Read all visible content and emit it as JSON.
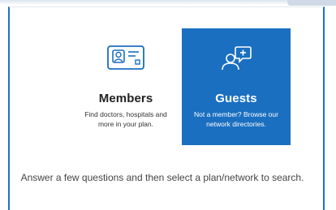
{
  "colors": {
    "accent": "#1a6fc0",
    "panel_border": "#1a73c7",
    "text_dark": "#222222",
    "text_muted": "#444444"
  },
  "cards": {
    "members": {
      "icon": "member-id-card-icon",
      "title": "Members",
      "description": "Find doctors, hospitals and more in your plan."
    },
    "guests": {
      "icon": "guest-chat-plus-icon",
      "title": "Guests",
      "description": "Not a member? Browse our network directories."
    }
  },
  "instructions": "Answer a few questions and then select a plan/network to search."
}
